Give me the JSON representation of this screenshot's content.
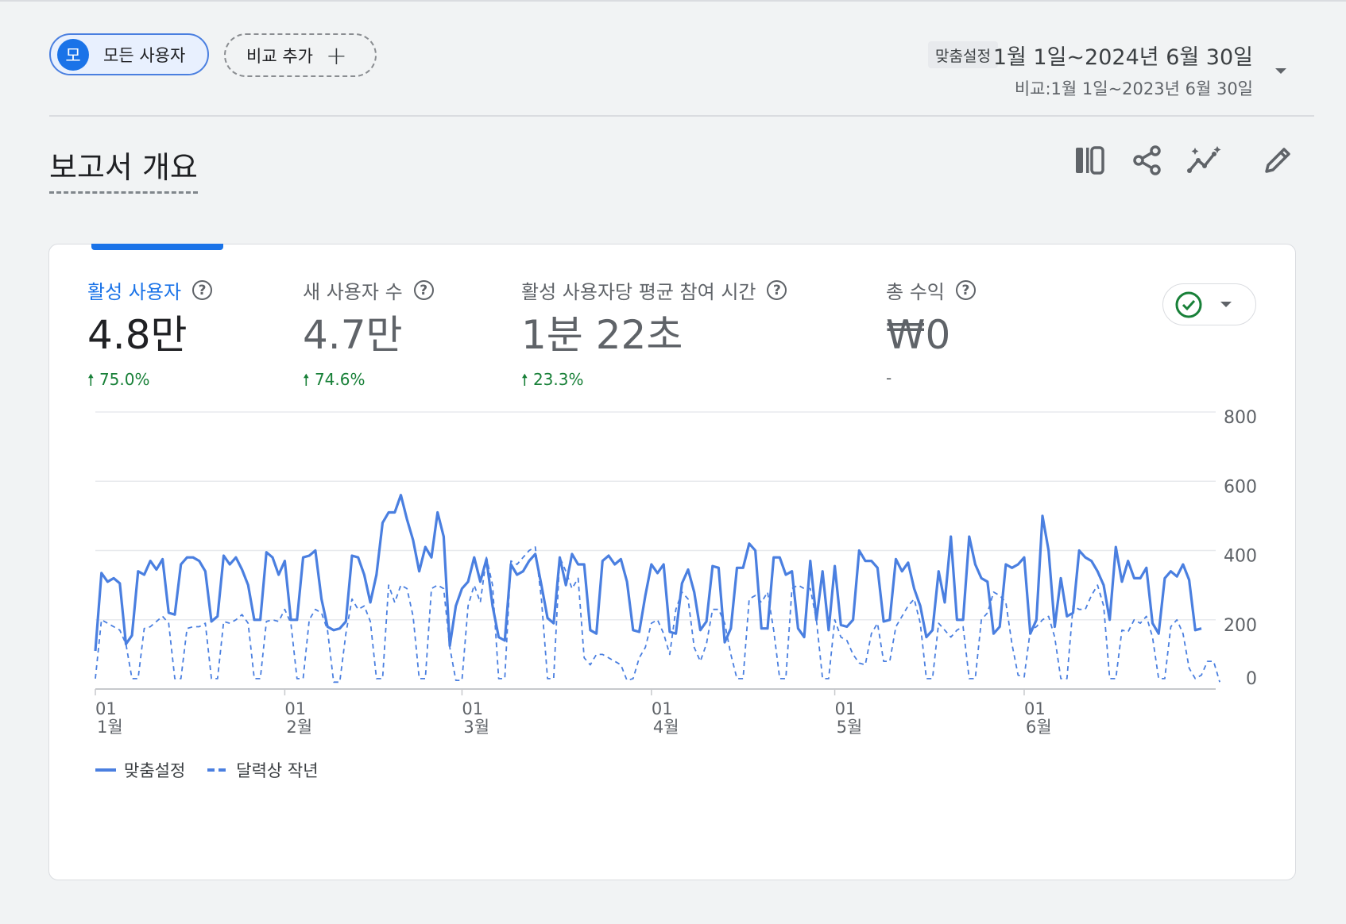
{
  "segment": {
    "active_badge": "모",
    "active_label": "모든 사용자",
    "add_compare_label": "비교 추가"
  },
  "date_range": {
    "badge": "맞춤설정",
    "main": "1월 1일~2024년 6월 30일",
    "compare": "비교:1월 1일~2023년 6월 30일"
  },
  "page": {
    "title": "보고서 개요"
  },
  "toolbar": {
    "icons": [
      "compare-columns-icon",
      "share-icon",
      "insights-icon",
      "edit-pencil-icon"
    ]
  },
  "metrics": [
    {
      "label": "활성 사용자",
      "value": "4.8만",
      "change": "75.0%",
      "active": true
    },
    {
      "label": "새 사용자 수",
      "value": "4.7만",
      "change": "74.6%",
      "active": false
    },
    {
      "label": "활성 사용자당 평균 참여 시간",
      "value": "1분 22초",
      "change": "23.3%",
      "active": false
    },
    {
      "label": "총 수익",
      "value": "₩0",
      "change": "-",
      "active": false
    }
  ],
  "help_glyph": "?",
  "up_arrow": "🠕",
  "colors": {
    "accent": "#1a73e8",
    "series": "#4a7fe0",
    "positive": "#188038"
  },
  "chart_data": {
    "type": "line",
    "ylim": [
      0,
      800
    ],
    "yticks": [
      "800",
      "600",
      "400",
      "200",
      "0"
    ],
    "ytick_values": [
      800,
      600,
      400,
      200,
      0
    ],
    "x_ticks": [
      {
        "day": "01",
        "month": "1월",
        "index": 0
      },
      {
        "day": "01",
        "month": "2월",
        "index": 31
      },
      {
        "day": "01",
        "month": "3월",
        "index": 60
      },
      {
        "day": "01",
        "month": "4월",
        "index": 91
      },
      {
        "day": "01",
        "month": "5월",
        "index": 121
      },
      {
        "day": "01",
        "month": "6월",
        "index": 152
      }
    ],
    "series": [
      {
        "name": "맞춤설정",
        "style": "solid",
        "values": [
          110,
          335,
          310,
          320,
          305,
          130,
          155,
          340,
          330,
          370,
          345,
          375,
          220,
          215,
          360,
          380,
          380,
          370,
          340,
          195,
          210,
          385,
          360,
          380,
          345,
          300,
          200,
          200,
          395,
          380,
          330,
          370,
          200,
          200,
          380,
          385,
          400,
          260,
          180,
          170,
          175,
          195,
          385,
          380,
          330,
          250,
          330,
          480,
          510,
          510,
          560,
          490,
          430,
          340,
          410,
          380,
          510,
          440,
          125,
          240,
          290,
          310,
          380,
          310,
          375,
          240,
          150,
          140,
          360,
          330,
          340,
          370,
          390,
          300,
          205,
          190,
          380,
          300,
          390,
          360,
          360,
          170,
          160,
          370,
          385,
          360,
          375,
          310,
          170,
          165,
          270,
          360,
          335,
          360,
          165,
          160,
          305,
          345,
          280,
          170,
          195,
          355,
          350,
          135,
          175,
          350,
          350,
          420,
          400,
          175,
          175,
          380,
          380,
          330,
          340,
          175,
          150,
          370,
          200,
          340,
          170,
          355,
          185,
          180,
          200,
          400,
          370,
          370,
          350,
          195,
          200,
          375,
          340,
          365,
          290,
          240,
          150,
          170,
          340,
          250,
          440,
          200,
          200,
          440,
          360,
          320,
          310,
          160,
          180,
          360,
          350,
          360,
          380,
          160,
          200,
          500,
          400,
          180,
          320,
          210,
          220,
          400,
          380,
          370,
          340,
          300,
          200,
          410,
          310,
          370,
          320,
          320,
          350,
          190,
          160,
          320,
          340,
          325,
          360,
          315,
          170,
          175
        ],
        "first_index": 0
      },
      {
        "name": "달력상 작년",
        "style": "dashed",
        "values": [
          30,
          200,
          190,
          180,
          170,
          130,
          30,
          30,
          175,
          180,
          195,
          210,
          190,
          30,
          30,
          175,
          180,
          180,
          190,
          30,
          30,
          195,
          190,
          200,
          215,
          190,
          30,
          30,
          195,
          200,
          195,
          230,
          190,
          30,
          30,
          200,
          230,
          220,
          170,
          20,
          20,
          160,
          260,
          230,
          240,
          195,
          30,
          30,
          300,
          250,
          300,
          290,
          210,
          30,
          30,
          290,
          300,
          290,
          120,
          25,
          25,
          240,
          300,
          250,
          380,
          300,
          30,
          30,
          370,
          360,
          380,
          400,
          410,
          260,
          30,
          30,
          380,
          340,
          290,
          320,
          90,
          70,
          100,
          100,
          90,
          80,
          70,
          25,
          30,
          90,
          120,
          190,
          200,
          160,
          100,
          230,
          280,
          260,
          120,
          80,
          130,
          230,
          230,
          190,
          100,
          30,
          30,
          260,
          270,
          250,
          280,
          170,
          30,
          30,
          290,
          300,
          290,
          290,
          200,
          30,
          30,
          200,
          150,
          140,
          100,
          75,
          70,
          160,
          190,
          80,
          80,
          180,
          210,
          240,
          260,
          190,
          30,
          30,
          190,
          170,
          150,
          170,
          180,
          30,
          30,
          200,
          220,
          280,
          270,
          250,
          130,
          40,
          35,
          170,
          180,
          200,
          210,
          150,
          30,
          30,
          240,
          230,
          230,
          270,
          300,
          240,
          30,
          30,
          170,
          165,
          200,
          190,
          210,
          150,
          30,
          30,
          180,
          200,
          160,
          60,
          30,
          40,
          80,
          80,
          20
        ],
        "first_index": 0
      }
    ]
  }
}
